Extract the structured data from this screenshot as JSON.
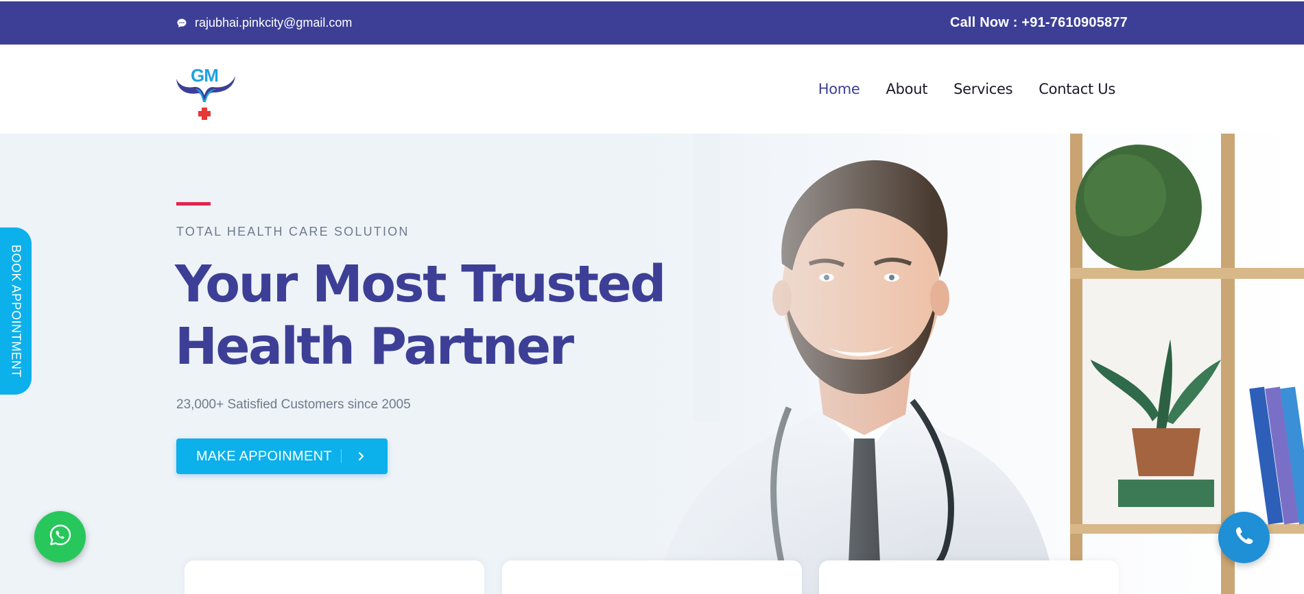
{
  "topbar": {
    "email": "rajubhai.pinkcity@gmail.com",
    "email_icon": "chat-bubble-icon",
    "call_label": "Call Now : +91-7610905877"
  },
  "brand": {
    "logo_text": "GM",
    "logo_colors": {
      "primary": "#3d3f96",
      "secondary": "#1da1e2",
      "cross": "#e53935"
    }
  },
  "nav": {
    "items": [
      {
        "label": "Home",
        "active": true
      },
      {
        "label": "About",
        "active": false
      },
      {
        "label": "Services",
        "active": false
      },
      {
        "label": "Contact Us",
        "active": false
      }
    ]
  },
  "hero": {
    "eyebrow": "TOTAL HEALTH CARE SOLUTION",
    "headline_line1": "Your Most Trusted",
    "headline_line2": "Health Partner",
    "subline": "23,000+ Satisfied Customers since 2005",
    "cta_label": "MAKE APPOINMENT",
    "cta_icon": "chevron-right-icon"
  },
  "floating": {
    "book_label": "BOOK APPOINTMENT",
    "whatsapp_icon": "whatsapp-icon",
    "phone_icon": "phone-icon"
  },
  "colors": {
    "brand_blue": "#3d3f96",
    "accent_cyan": "#0cb0eb",
    "accent_red": "#e0264f",
    "whatsapp_green": "#27c75b",
    "muted_text": "#6f7a8a"
  }
}
